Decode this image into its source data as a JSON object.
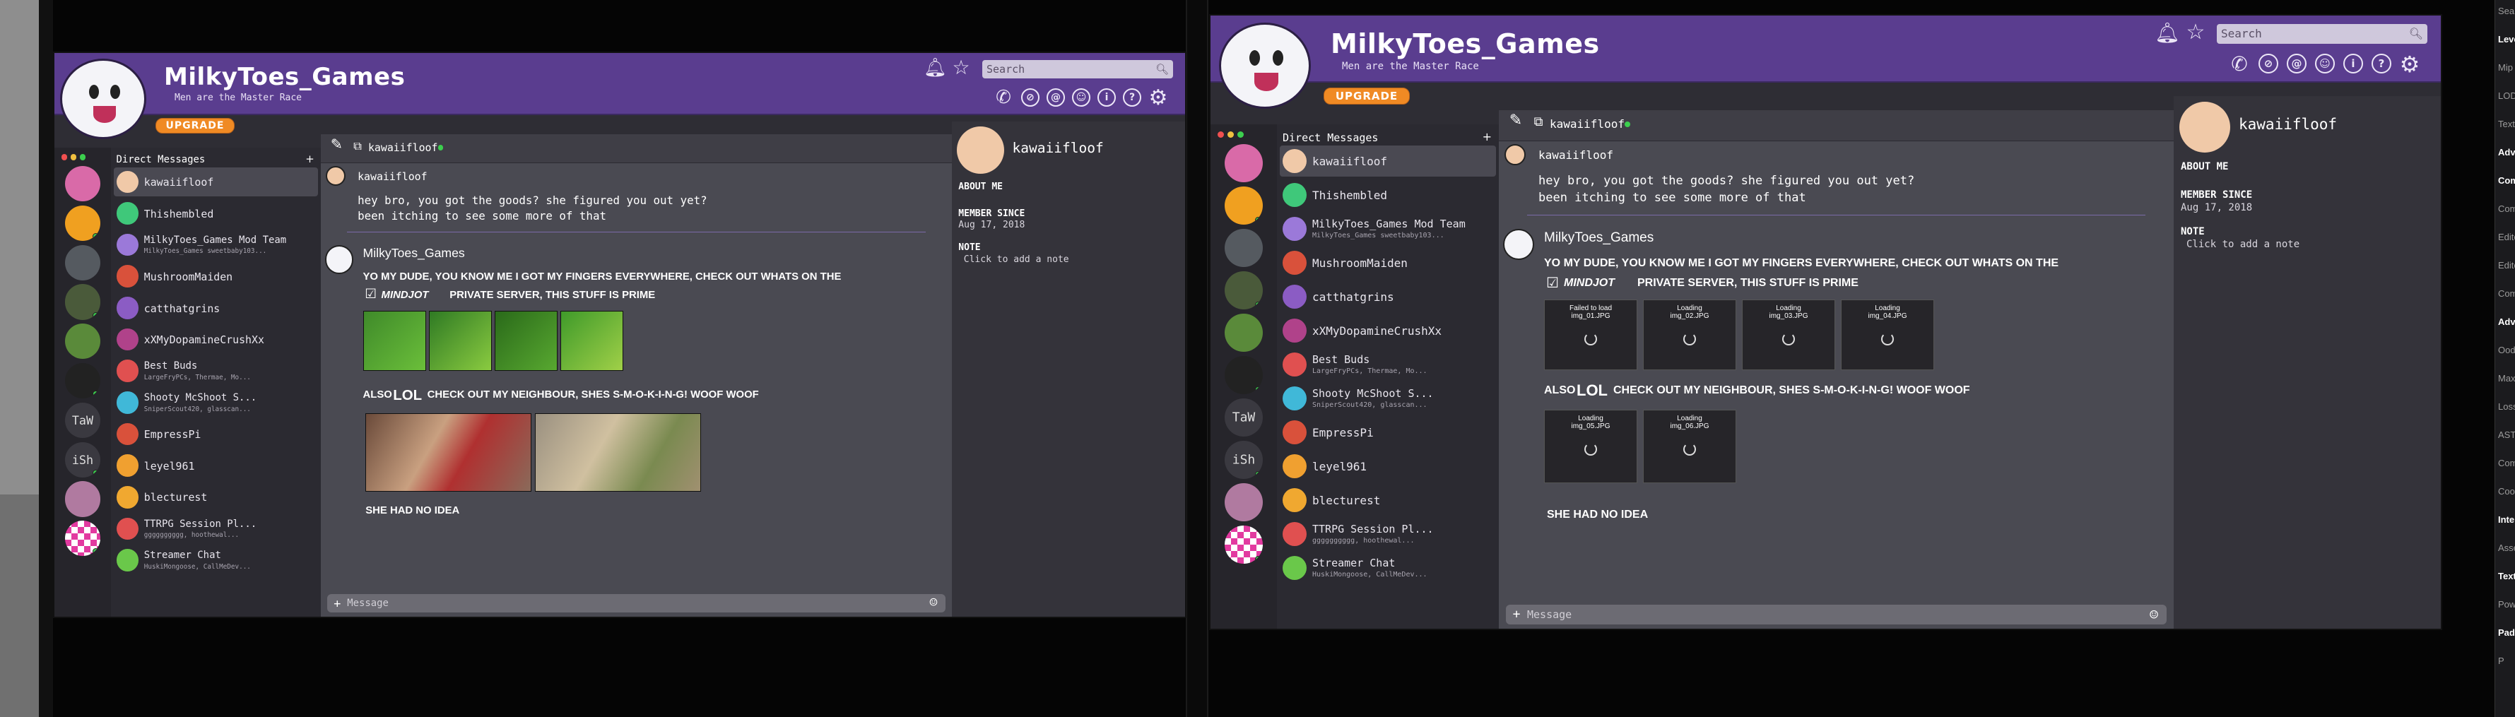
{
  "profile_name": "MilkyToes_Games",
  "tagline": "Men are the Master Race",
  "search_placeholder": "Search",
  "upgrade_label": "UPGRADE",
  "dm_header": "Direct Messages",
  "dm_add": "+",
  "chat_user": "kawaiifloof",
  "composer_placeholder": "Message",
  "dms": [
    {
      "name": "kawaiifloof",
      "sub": "",
      "color": "#f0c9a8"
    },
    {
      "name": "Thishembled",
      "sub": "",
      "color": "#3fc87a"
    },
    {
      "name": "MilkyToes_Games Mod Team",
      "sub": "MilkyToes_Games sweetbaby103...",
      "color": "#9b79d9"
    },
    {
      "name": "MushroomMaiden",
      "sub": "",
      "color": "#d9513b"
    },
    {
      "name": "catthatgrins",
      "sub": "",
      "color": "#8b5cc4"
    },
    {
      "name": "xXMyDopamineCrushXx",
      "sub": "",
      "color": "#b0428a"
    },
    {
      "name": "Best Buds",
      "sub": "LargeFryPCs, Thermae, Mo...",
      "color": "#e05050"
    },
    {
      "name": "Shooty McShoot S...",
      "sub": "SniperScout420, glasscan...",
      "color": "#40b8d8"
    },
    {
      "name": "EmpressPi",
      "sub": "",
      "color": "#d9513b"
    },
    {
      "name": "leyel961",
      "sub": "",
      "color": "#f0a030"
    },
    {
      "name": "blecturest",
      "sub": "",
      "color": "#f0a830"
    },
    {
      "name": "TTRPG Session Pl...",
      "sub": "gggggggggg, hoothewal...",
      "color": "#e05050"
    },
    {
      "name": "Streamer Chat",
      "sub": "HuskiMongoose, CallMeDev...",
      "color": "#6ac84a"
    }
  ],
  "servers_right": [
    "TaW",
    "iSh"
  ],
  "messages": {
    "first_author": "kawaiifloof",
    "first_line1": "hey bro, you got the goods? she figured you out yet?",
    "first_line2": "been itching to see some more of that",
    "second_author": "MilkyToes_Games",
    "line_a": "YO MY DUDE, YOU KNOW ME I GOT MY FINGERS EVERYWHERE, CHECK OUT WHATS ON THE",
    "brand": "MINDJOT",
    "line_b": "PRIVATE SERVER, THIS STUFF IS PRIME",
    "line_c_pre": "ALSO",
    "line_c_lol": "LOL",
    "line_c_post": "CHECK OUT MY NEIGHBOUR, SHES S-M-O-K-I-N-G! WOOF WOOF",
    "line_d": "SHE HAD NO IDEA"
  },
  "loading_tiles": [
    {
      "label": "Failed to load",
      "file": "img_01.JPG"
    },
    {
      "label": "Loading",
      "file": "img_02.JPG"
    },
    {
      "label": "Loading",
      "file": "img_03.JPG"
    },
    {
      "label": "Loading",
      "file": "img_04.JPG"
    },
    {
      "label": "Loading",
      "file": "img_05.JPG"
    },
    {
      "label": "Loading",
      "file": "img_06.JPG"
    }
  ],
  "about": {
    "about_label": "ABOUT ME",
    "since_label": "MEMBER SINCE",
    "since_value": "Aug 17, 2018",
    "note_label": "NOTE",
    "note_value": "Click to add a note"
  },
  "editor_rows": [
    "Search",
    "Level Of",
    "Mip Gen",
    "LOD Bia",
    "Texture",
    "Advance",
    "Compre",
    "Compre",
    "Editor S",
    "Editor D",
    "Compre",
    "Advance",
    "Oodle T",
    "Maximu",
    "Lossy C",
    "ASTC C",
    "Compre",
    "Cook Pl",
    "Intercha",
    "Assetin",
    "Texture",
    "Power O",
    "Paddin",
    "P"
  ]
}
